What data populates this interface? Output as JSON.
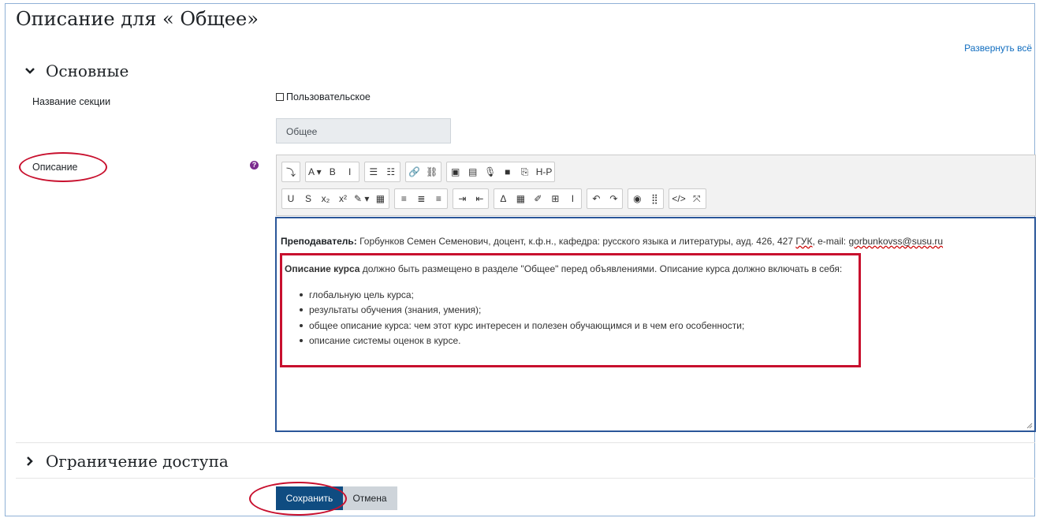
{
  "page": {
    "title": "Описание для « Общее»",
    "expand_all": "Развернуть всё"
  },
  "sections": {
    "general": "Основные",
    "restrictions": "Ограничение доступа"
  },
  "fields": {
    "section_name_label": "Название секции",
    "custom_checkbox_label": "Пользовательское",
    "section_name_value": "Общее",
    "description_label": "Описание"
  },
  "toolbar": {
    "row1": [
      [
        "toggle-toolbar-icon",
        "⤵"
      ],
      [
        "font-style-icon",
        "A ▾"
      ],
      [
        "bold-icon",
        "B"
      ],
      [
        "italic-icon",
        "I"
      ],
      [
        "unordered-list-icon",
        "☰"
      ],
      [
        "ordered-list-icon",
        "☷"
      ],
      [
        "link-icon",
        "🔗"
      ],
      [
        "unlink-icon",
        "⛓"
      ],
      [
        "image-icon",
        "▣"
      ],
      [
        "media-icon",
        "▤"
      ],
      [
        "record-audio-icon",
        "🎙"
      ],
      [
        "record-video-icon",
        "■"
      ],
      [
        "manage-files-icon",
        "⎘"
      ],
      [
        "h5p-icon",
        "H-P"
      ]
    ],
    "row2": [
      [
        "underline-icon",
        "U"
      ],
      [
        "strikethrough-icon",
        "S"
      ],
      [
        "subscript-icon",
        "x₂"
      ],
      [
        "superscript-icon",
        "x²"
      ],
      [
        "font-color-icon",
        "✎ ▾"
      ],
      [
        "paste-text-icon",
        "▦"
      ],
      [
        "align-left-icon",
        "≡"
      ],
      [
        "align-center-icon",
        "≣"
      ],
      [
        "align-right-icon",
        "≡"
      ],
      [
        "indent-icon",
        "⇥"
      ],
      [
        "outdent-icon",
        "⇤"
      ],
      [
        "equation-icon",
        "Δ"
      ],
      [
        "calculator-icon",
        "▦"
      ],
      [
        "edit-icon",
        "✐"
      ],
      [
        "table-icon",
        "⊞"
      ],
      [
        "text-cursor-icon",
        "I"
      ],
      [
        "undo-icon",
        "↶"
      ],
      [
        "redo-icon",
        "↷"
      ],
      [
        "accessibility-icon",
        "◉"
      ],
      [
        "special-chars-icon",
        "⣿"
      ],
      [
        "html-icon",
        "</>"
      ],
      [
        "fullscreen-icon",
        "⤧"
      ]
    ]
  },
  "editor": {
    "teacher_label": "Преподаватель:",
    "teacher_text": " Горбунков Семен Семенович, доцент, к.ф.н., кафедра: русского языка и литературы, ауд. 426, 427 ",
    "building": "ГУК",
    "email_prefix": ", e-mail: ",
    "email": "gorbunkovss@susu.ru",
    "desc_bold": "Описание курса",
    "desc_text": " должно быть размещено в разделе \"Общее\" перед объявлениями. Описание курса должно включать в себя:",
    "items": [
      "глобальную цель курса;",
      "результаты обучения (знания, умения);",
      "общее описание курса: чем этот курс интересен и полезен обучающимся и в чем его особенности;",
      "описание системы оценок в курсе."
    ]
  },
  "buttons": {
    "save": "Сохранить",
    "cancel": "Отмена"
  },
  "colors": {
    "primary": "#0f4c81",
    "link": "#0f6cbf",
    "annotation_red": "#c8102e",
    "editor_border": "#2a5699",
    "help_icon": "#7b2b8e"
  }
}
